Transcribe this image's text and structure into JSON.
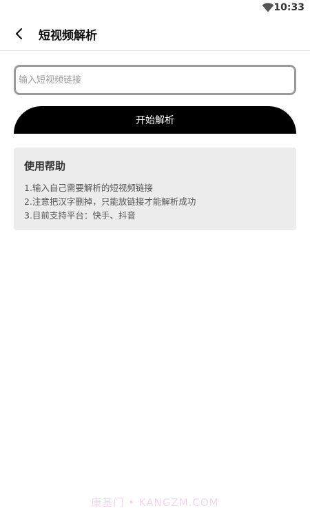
{
  "status_bar": {
    "time": "10:33"
  },
  "app_bar": {
    "title": "短视频解析"
  },
  "input": {
    "placeholder": "输入短视频链接",
    "value": ""
  },
  "button": {
    "label": "开始解析"
  },
  "help": {
    "title": "使用帮助",
    "lines": [
      "1.输入自己需要解析的短视频链接",
      "2.注意把汉字删掉，只能放链接才能解析成功",
      "3.目前支持平台：快手、抖音"
    ]
  },
  "watermark": "康基门 • KANGZM.COM",
  "colors": {
    "button_bg": "#000000",
    "card_bg": "#ececec",
    "input_border": "#9a9a9a"
  }
}
